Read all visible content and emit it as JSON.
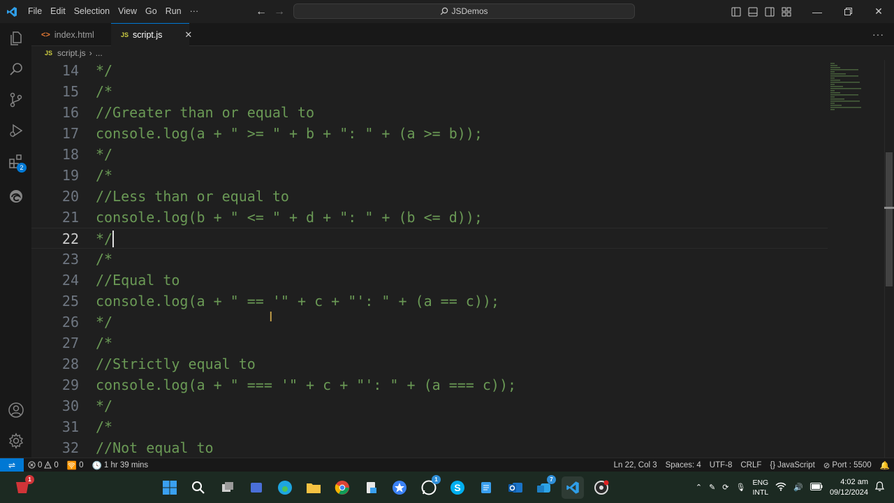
{
  "titlebar": {
    "menu": [
      "File",
      "Edit",
      "Selection",
      "View",
      "Go",
      "Run",
      "···"
    ],
    "search": "JSDemos"
  },
  "tabs": [
    {
      "icon": "<>",
      "label": "index.html",
      "active": false
    },
    {
      "icon": "JS",
      "label": "script.js",
      "active": true
    }
  ],
  "breadcrumb": {
    "icon": "JS",
    "file": "script.js",
    "rest": "..."
  },
  "editor": {
    "current_line": 22,
    "lines": [
      {
        "n": "14",
        "text": "*/"
      },
      {
        "n": "15",
        "text": "/*"
      },
      {
        "n": "16",
        "text": "//Greater than or equal to"
      },
      {
        "n": "17",
        "text": "console.log(a + \" >= \" + b + \": \" + (a >= b));"
      },
      {
        "n": "18",
        "text": "*/"
      },
      {
        "n": "19",
        "text": "/*"
      },
      {
        "n": "20",
        "text": "//Less than or equal to"
      },
      {
        "n": "21",
        "text": "console.log(b + \" <= \" + d + \": \" + (b <= d));"
      },
      {
        "n": "22",
        "text": "*/"
      },
      {
        "n": "23",
        "text": "/*"
      },
      {
        "n": "24",
        "text": "//Equal to"
      },
      {
        "n": "25",
        "text": "console.log(a + \" == '\" + c + \"': \" + (a == c));"
      },
      {
        "n": "26",
        "text": "*/"
      },
      {
        "n": "27",
        "text": "/*"
      },
      {
        "n": "28",
        "text": "//Strictly equal to"
      },
      {
        "n": "29",
        "text": "console.log(a + \" === '\" + c + \"': \" + (a === c));"
      },
      {
        "n": "30",
        "text": "*/"
      },
      {
        "n": "31",
        "text": "/*"
      },
      {
        "n": "32",
        "text": "//Not equal to"
      }
    ]
  },
  "activity_badge": "2",
  "status": {
    "errors": "0",
    "warnings": "0",
    "ports": "0",
    "time": "1 hr 39 mins",
    "position": "Ln 22, Col 3",
    "spaces": "Spaces: 4",
    "encoding": "UTF-8",
    "eol": "CRLF",
    "language": "JavaScript",
    "port": "Port : 5500"
  },
  "taskbar": {
    "badges": {
      "start": "1",
      "whatsapp": "1",
      "teams": "7"
    },
    "lang_top": "ENG",
    "lang_bottom": "INTL",
    "time": "4:02 am",
    "date": "09/12/2024"
  },
  "colors": {
    "accent": "#0078d4",
    "comment": "#6a9955",
    "editor_bg": "#1f1f1f"
  }
}
